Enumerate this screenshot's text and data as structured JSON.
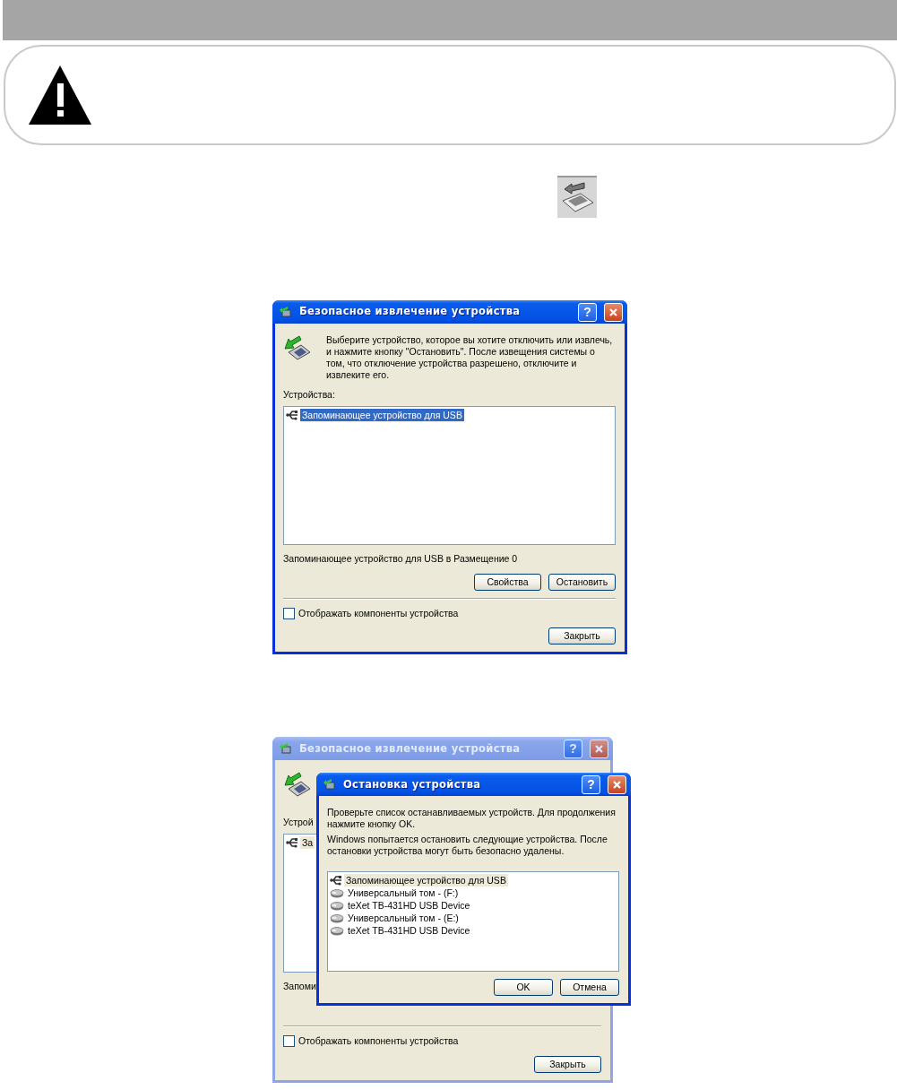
{
  "dialogs": [
    {
      "title": "Безопасное извлечение устройства",
      "active": true,
      "help_label": "?",
      "message": "Выберите устройство, которое вы хотите отключить или извлечь, и нажмите кнопку \"Остановить\". После извещения системы о том, что отключение устройства разрешено, отключите и извлеките его.",
      "list_label": "Устройства:",
      "list_focused": true,
      "devices": [
        {
          "label": "Запоминающее устройство для USB",
          "kind": "usb",
          "selected": true
        }
      ],
      "status": "Запоминающее устройство для USB в Размещение 0",
      "action_buttons": [
        "Свойства",
        "Остановить"
      ],
      "checkbox": {
        "label": "Отображать компоненты устройства",
        "checked": false
      },
      "close_button": "Закрыть"
    },
    {
      "title": "Безопасное извлечение устройства",
      "active": false,
      "help_label": "?",
      "list_label": "Устрой",
      "list_focused": false,
      "devices": [
        {
          "label": "За",
          "kind": "usb",
          "selected": true
        }
      ],
      "status": "Запоми",
      "checkbox": {
        "label": "Отображать компоненты устройства",
        "checked": false
      },
      "close_button": "Закрыть"
    }
  ],
  "stop_dialog": {
    "title": "Остановка устройства",
    "active": true,
    "help_label": "?",
    "messages": [
      "Проверьте список останавливаемых устройств. Для продолжения нажмите кнопку OK.",
      "Windows попытается остановить следующие устройства. После остановки устройства могут быть безопасно удалены."
    ],
    "list_focused": false,
    "devices": [
      {
        "label": "Запоминающее устройство для USB",
        "kind": "usb",
        "selected": true
      },
      {
        "label": "Универсальный том - (F:)",
        "kind": "disk",
        "selected": false
      },
      {
        "label": "teXet TB-431HD USB Device",
        "kind": "disk",
        "selected": false
      },
      {
        "label": "Универсальный том - (E:)",
        "kind": "disk",
        "selected": false
      },
      {
        "label": "teXet TB-431HD USB Device",
        "kind": "disk",
        "selected": false
      }
    ],
    "buttons": [
      "OK",
      "Отмена"
    ]
  }
}
